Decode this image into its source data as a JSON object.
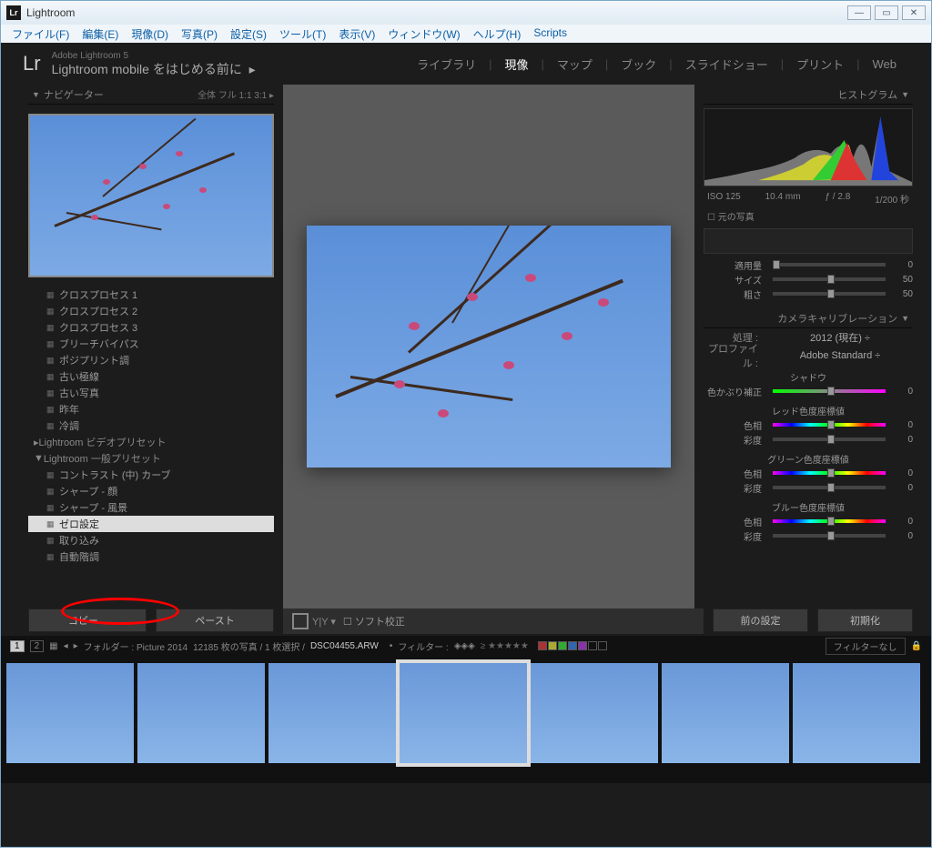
{
  "window": {
    "title": "Lightroom"
  },
  "menubar": [
    "ファイル(F)",
    "編集(E)",
    "現像(D)",
    "写真(P)",
    "設定(S)",
    "ツール(T)",
    "表示(V)",
    "ウィンドウ(W)",
    "ヘルプ(H)",
    "Scripts"
  ],
  "brand": {
    "sub": "Adobe Lightroom 5",
    "main": "Lightroom mobile をはじめる前に"
  },
  "modules": [
    "ライブラリ",
    "現像",
    "マップ",
    "ブック",
    "スライドショー",
    "プリント",
    "Web"
  ],
  "active_module": "現像",
  "nav": {
    "title": "ナビゲーター",
    "opts": "全体  フル   1:1   3:1 ▸"
  },
  "presets": {
    "items": [
      "クロスプロセス 1",
      "クロスプロセス 2",
      "クロスプロセス 3",
      "ブリーチバイパス",
      "ポジプリント調",
      "古い極線",
      "古い写真",
      "昨年",
      "冷調"
    ],
    "group1": "Lightroom ビデオプリセット",
    "group2": "Lightroom 一般プリセット",
    "sub": [
      "コントラスト (中) カーブ",
      "シャープ - 顔",
      "シャープ - 風景",
      "ゼロ設定",
      "取り込み",
      "自動階調"
    ]
  },
  "buttons": {
    "copy": "コピー...",
    "paste": "ペースト",
    "prev": "前の設定",
    "reset": "初期化"
  },
  "softproof": "ソフト校正",
  "histogram": {
    "title": "ヒストグラム",
    "iso": "ISO 125",
    "focal": "10.4 mm",
    "aperture": "ƒ / 2.8",
    "shutter": "1/200 秒",
    "original": "元の写真"
  },
  "adj": {
    "amount": "適用量",
    "size": "サイズ",
    "rough": "粗さ",
    "v_amount": "0",
    "v_size": "50",
    "v_rough": "50"
  },
  "calib": {
    "title": "カメラキャリブレーション",
    "process_l": "処理 :",
    "process_v": "2012 (現在) ÷",
    "profile_l": "プロファイル :",
    "profile_v": "Adobe Standard ÷",
    "shadow": "シャドウ",
    "tint": "色かぶり補正",
    "red": "レッド色度座標値",
    "green": "グリーン色度座標値",
    "blue": "ブルー色度座標値",
    "hue": "色相",
    "sat": "彩度",
    "zero": "0"
  },
  "filmstrip": {
    "folder": "フォルダー : Picture 2014",
    "count": "12185 枚の写真 / 1 枚選択 /",
    "file": "DSC04455.ARW",
    "filter": "フィルター :",
    "nofilter": "フィルターなし"
  },
  "pages": {
    "p1": "1",
    "p2": "2"
  }
}
